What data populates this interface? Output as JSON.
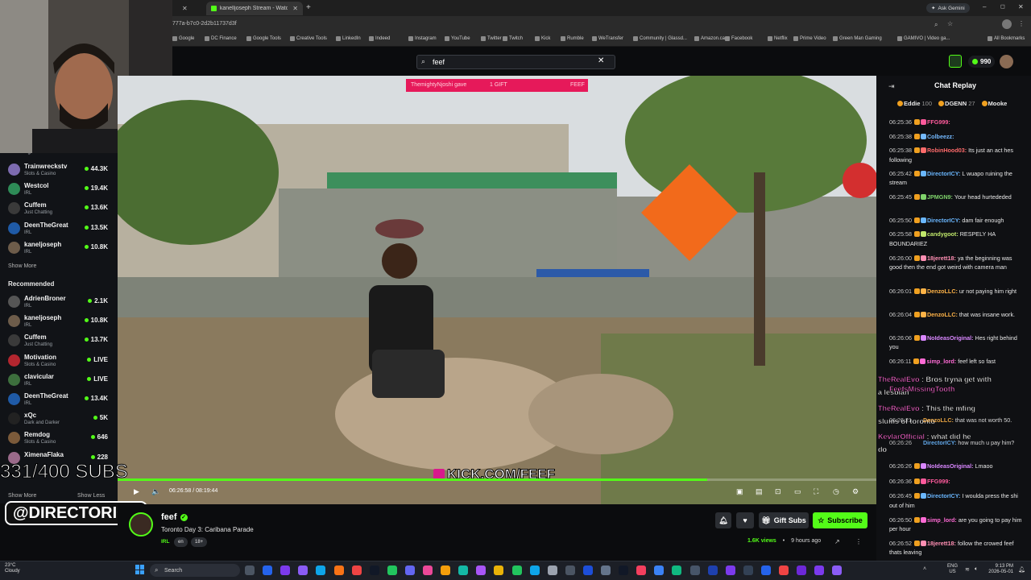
{
  "browser": {
    "tabs": [
      {
        "label": "",
        "active": false
      },
      {
        "label": "kanelljoseph Stream - Watch Li",
        "active": true
      }
    ],
    "url": "777a-b7c0-2d2b11737d3f",
    "ask_gemini": "Ask Gemini",
    "bookmarks": [
      "Google",
      "DC Finance",
      "Google Tools",
      "Creative Tools",
      "LinkedIn",
      "Indeed",
      "Instagram",
      "YouTube",
      "Twitter",
      "Twitch",
      "Kick",
      "Rumble",
      "WeTransfer",
      "Community | Glassd...",
      "Amazon.ca",
      "Facebook",
      "Netflix",
      "Prime Video",
      "Green Man Gaming",
      "GAMIVO | Video ga..."
    ],
    "all_bookmarks": "All Bookmarks"
  },
  "kick_header": {
    "search_value": "feef",
    "points": "990"
  },
  "sidebar": {
    "following_title": "Following",
    "following": [
      {
        "name": "Trainwreckstv",
        "category": "Slots & Casino",
        "viewers": "44.3K",
        "color": "#7d6bb0"
      },
      {
        "name": "Westcol",
        "category": "IRL",
        "viewers": "19.4K",
        "color": "#2e8b57"
      },
      {
        "name": "Cuffem",
        "category": "Just Chatting",
        "viewers": "13.6K",
        "color": "#3a3a3a"
      },
      {
        "name": "DeenTheGreat",
        "category": "IRL",
        "viewers": "13.5K",
        "color": "#1f5aa6"
      },
      {
        "name": "kaneljoseph",
        "category": "IRL",
        "viewers": "10.8K",
        "color": "#6d5c4a"
      }
    ],
    "show_more": "Show More",
    "recommended_title": "Recommended",
    "recommended": [
      {
        "name": "AdrienBroner",
        "category": "IRL",
        "viewers": "2.1K",
        "color": "#555"
      },
      {
        "name": "kaneljoseph",
        "category": "IRL",
        "viewers": "10.8K",
        "color": "#6d5c4a"
      },
      {
        "name": "Cuffem",
        "category": "Just Chatting",
        "viewers": "13.7K",
        "color": "#3a3a3a"
      },
      {
        "name": "Motivation",
        "category": "Slots & Casino",
        "viewers": "LIVE",
        "color": "#b3262f"
      },
      {
        "name": "clavicular",
        "category": "IRL",
        "viewers": "LIVE",
        "color": "#3d6f3d"
      },
      {
        "name": "DeenTheGreat",
        "category": "IRL",
        "viewers": "13.4K",
        "color": "#1f5aa6"
      },
      {
        "name": "xQc",
        "category": "Dark and Darker",
        "viewers": "5K",
        "color": "#222"
      },
      {
        "name": "Remdog",
        "category": "Slots & Casino",
        "viewers": "646",
        "color": "#7b5a3a"
      },
      {
        "name": "XimenaFlaka",
        "category": "",
        "viewers": "228",
        "color": "#9a6a8a"
      }
    ],
    "show_more_2": "Show More",
    "show_less": "Show Less"
  },
  "video": {
    "overlay_subs": "331/400 SUBS",
    "overlay_handle": "@DIRECTORICY",
    "overlay_url": "KICK.COM/FEEF",
    "banner_left": "ThemightyNjoshi gave",
    "banner_mid": "1 GIFT",
    "banner_right": "FEEF",
    "time_current": "06:26:58",
    "time_total": "08:19:44",
    "progress": 0.777
  },
  "stream_info": {
    "channel": "feef",
    "title": "Toronto Day 3: Caribana Parade",
    "tags": [
      "IRL",
      "en",
      "18+"
    ],
    "views": "1.6K views",
    "age": "9 hours ago",
    "gift_subs": "Gift Subs",
    "subscribe": "Subscribe"
  },
  "chat": {
    "title": "Chat Replay",
    "top": [
      {
        "name": "Eddie",
        "value": "100"
      },
      {
        "name": "DGENN",
        "value": "27"
      },
      {
        "name": "Mooke",
        "value": ""
      }
    ],
    "messages": [
      {
        "time": "06:25:36",
        "user": "FFG999:",
        "color": "#ff5a9c",
        "text": ""
      },
      {
        "time": "06:25:38",
        "user": "Colbeezz:",
        "color": "#74b9ff",
        "text": ""
      },
      {
        "time": "06:25:38",
        "user": "RobinHood03:",
        "color": "#ff6b6b",
        "text": "Its just an act hes following"
      },
      {
        "time": "06:25:42",
        "user": "DirectorICY:",
        "color": "#6ab7ff",
        "text": "L wuapo ruining the stream"
      },
      {
        "time": "06:25:45",
        "user": "JPMGN9:",
        "color": "#7fd36b",
        "text": "Your head hurtededed"
      },
      {
        "time": "06:25:50",
        "user": "DirectorICY:",
        "color": "#6ab7ff",
        "text": "dam fair enough"
      },
      {
        "time": "06:25:58",
        "user": "candygoot:",
        "color": "#c0e86b",
        "text": "RESPELY HA BOUNDARIEZ"
      },
      {
        "time": "06:26:00",
        "user": "18jerett18:",
        "color": "#ff8fb3",
        "text": "ya the beginning was good then the end got weird with camera man"
      },
      {
        "time": "06:26:01",
        "user": "DenzoLLC:",
        "color": "#ffb347",
        "text": "ur not paying him right"
      },
      {
        "time": "06:26:04",
        "user": "DenzoLLC:",
        "color": "#ffb347",
        "text": "that was insane work."
      },
      {
        "time": "06:26:06",
        "user": "NoIdeasOriginal:",
        "color": "#d987ff",
        "text": "Hes right behind you"
      },
      {
        "time": "06:26:11",
        "user": "simp_lord:",
        "color": "#ff6bd5",
        "text": "feef left so fast"
      }
    ],
    "overlays": [
      {
        "user": "TheRealEvo",
        "text": "Bros tryna get with"
      },
      {
        "user": "",
        "text": "a lesbian"
      },
      {
        "user": "FeefsMissingTooth",
        "text": ""
      },
      {
        "user": "TheRealEvo",
        "text": "This the mfing"
      },
      {
        "user": "",
        "text": "slums of toronto"
      },
      {
        "user": "KevlarOfficial",
        "text": "what did he"
      },
      {
        "user": "",
        "text": "do"
      }
    ],
    "hidden_lines": [
      {
        "time": "06:26:21",
        "user": "DenzoLLC:",
        "color": "#ffb347",
        "text": "that was not worth 50."
      },
      {
        "time": "06:26:26",
        "user": "DirectorICY:",
        "color": "#6ab7ff",
        "text": "how much u pay him?"
      }
    ],
    "messages2": [
      {
        "time": "06:26:26",
        "user": "NoIdeasOriginal:",
        "color": "#d987ff",
        "text": "Lmaoo"
      },
      {
        "time": "06:26:36",
        "user": "FFG999:",
        "color": "#ff5a9c",
        "text": ""
      },
      {
        "time": "06:26:45",
        "user": "DirectorICY:",
        "color": "#6ab7ff",
        "text": "I woulda press the shi out of him"
      },
      {
        "time": "06:26:50",
        "user": "simp_lord:",
        "color": "#ff6bd5",
        "text": "are you going to pay him per hour"
      },
      {
        "time": "06:26:52",
        "user": "18jerett18:",
        "color": "#ff8fb3",
        "text": "follow the crowed feef thats leaving"
      }
    ]
  },
  "taskbar": {
    "weather_temp": "23°C",
    "weather_desc": "Cloudy",
    "search": "Search",
    "lang": "ENG",
    "region": "US",
    "time": "9:13 PM",
    "date": "2026-05-01"
  }
}
